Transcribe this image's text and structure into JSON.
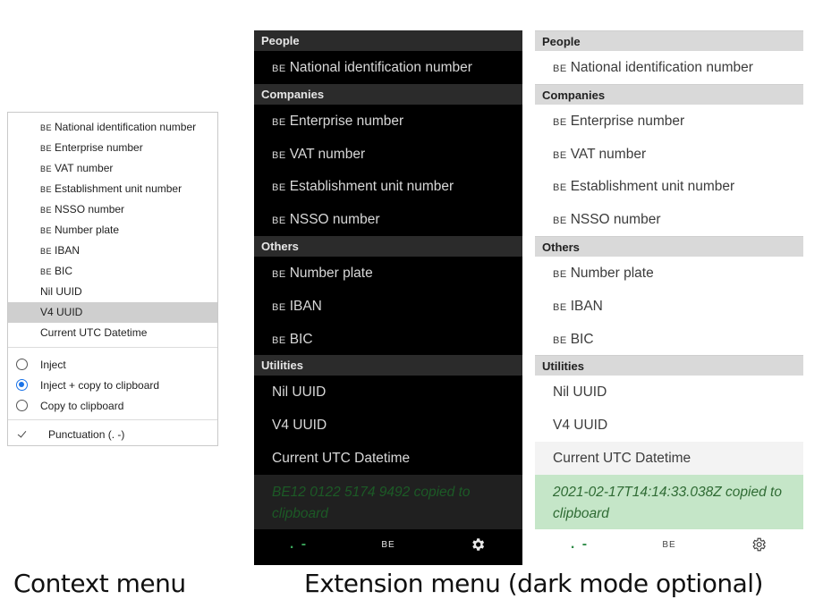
{
  "country_prefix": "BE",
  "context_menu": {
    "items": [
      {
        "prefix": "BE",
        "label": "National identification number"
      },
      {
        "prefix": "BE",
        "label": "Enterprise number"
      },
      {
        "prefix": "BE",
        "label": "VAT number"
      },
      {
        "prefix": "BE",
        "label": "Establishment unit number"
      },
      {
        "prefix": "BE",
        "label": "NSSO number"
      },
      {
        "prefix": "BE",
        "label": "Number plate"
      },
      {
        "prefix": "BE",
        "label": "IBAN"
      },
      {
        "prefix": "BE",
        "label": "BIC"
      },
      {
        "prefix": "",
        "label": "Nil UUID"
      },
      {
        "prefix": "",
        "label": "V4 UUID",
        "highlighted": true
      },
      {
        "prefix": "",
        "label": "Current UTC Datetime"
      }
    ],
    "modes": [
      {
        "label": "Inject",
        "selected": false
      },
      {
        "label": "Inject + copy to clipboard",
        "selected": true
      },
      {
        "label": "Copy to clipboard",
        "selected": false
      }
    ],
    "punctuation": {
      "label": "Punctuation (. -)",
      "checked": true
    }
  },
  "extension_dark": {
    "sections": {
      "people": "People",
      "companies": "Companies",
      "others": "Others",
      "utilities": "Utilities"
    },
    "people": [
      "National identification number"
    ],
    "companies": [
      "Enterprise number",
      "VAT number",
      "Establishment unit number",
      "NSSO number"
    ],
    "others": [
      "Number plate",
      "IBAN",
      "BIC"
    ],
    "utilities": [
      "Nil UUID",
      "V4 UUID",
      "Current UTC Datetime"
    ],
    "toast": "BE12 0122 5174 9492 copied to clipboard",
    "bottom_bar": {
      "punctuation_label": ". -",
      "country_label": "BE",
      "settings_icon": "gear-icon"
    }
  },
  "extension_light": {
    "sections": {
      "people": "People",
      "companies": "Companies",
      "others": "Others",
      "utilities": "Utilities"
    },
    "people": [
      "National identification number"
    ],
    "companies": [
      "Enterprise number",
      "VAT number",
      "Establishment unit number",
      "NSSO number"
    ],
    "others": [
      "Number plate",
      "IBAN",
      "BIC"
    ],
    "utilities": [
      "Nil UUID",
      "V4 UUID",
      "Current UTC Datetime"
    ],
    "toast": "2021-02-17T14:14:33.038Z copied to clipboard",
    "bottom_bar": {
      "punctuation_label": ". -",
      "country_label": "BE",
      "settings_icon": "gear-icon"
    }
  },
  "captions": {
    "left": "Context menu",
    "right": "Extension menu (dark mode optional)"
  },
  "colors": {
    "radio_selected": "#1a73e8",
    "toast_light_bg": "#c5e6c8",
    "toast_dark_text": "#1c5a26",
    "punctuation_green": "#2e8b47"
  }
}
